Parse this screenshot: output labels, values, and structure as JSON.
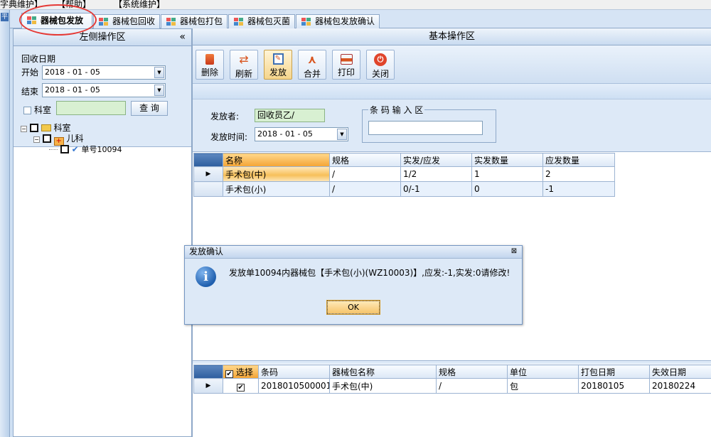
{
  "menubar": {
    "items": [
      "字典维护】",
      "【帮助】",
      "【系统维护】"
    ]
  },
  "tabs": [
    {
      "label": "器械包发放",
      "active": true
    },
    {
      "label": "器械包回收"
    },
    {
      "label": "器械包打包"
    },
    {
      "label": "器械包灭菌"
    },
    {
      "label": "器械包发放确认"
    }
  ],
  "left": {
    "title": "左侧操作区",
    "collapse": "«",
    "recycle_date_label": "回收日期",
    "start_label": "开始",
    "start_value": "2018 - 01 - 05",
    "end_label": "结束",
    "end_value": "2018 - 01 - 05",
    "dept_label": "科室",
    "query_button": "查 询",
    "tree": {
      "root": "科室",
      "child": "儿科",
      "leaf": "单号10094"
    }
  },
  "right": {
    "title": "基本操作区",
    "toolbar": [
      "删除",
      "刷新",
      "发放",
      "合并",
      "打印",
      "关闭"
    ],
    "issuer_label": "发放者:",
    "issuer_value": "回收员乙/",
    "time_label": "发放时间:",
    "time_value": "2018 - 01 - 05",
    "barcode_legend": "条 码 输 入 区"
  },
  "grid1": {
    "headers": [
      "名称",
      "规格",
      "实发/应发",
      "实发数量",
      "应发数量"
    ],
    "rows": [
      [
        "手术包(中)",
        "/",
        "1/2",
        "1",
        "2"
      ],
      [
        "手术包(小)",
        "/",
        "0/-1",
        "0",
        "-1"
      ]
    ]
  },
  "grid2": {
    "headers": [
      "选择",
      "条码",
      "器械包名称",
      "规格",
      "单位",
      "打包日期",
      "失效日期"
    ],
    "rows": [
      [
        "",
        "2018010500001",
        "手术包(中)",
        "/",
        "包",
        "20180105",
        "20180224"
      ]
    ]
  },
  "dialog": {
    "title": "发放确认",
    "close": "⊠",
    "message": "发放单10094内器械包【手术包(小)(WZ10003)】,应发:-1,实发:0请修改!",
    "ok": "OK"
  },
  "colors": {
    "accent": "#f4a434",
    "panel": "#dde9f7",
    "border": "#8ea8c8",
    "info_icon": "#1f5fae"
  }
}
